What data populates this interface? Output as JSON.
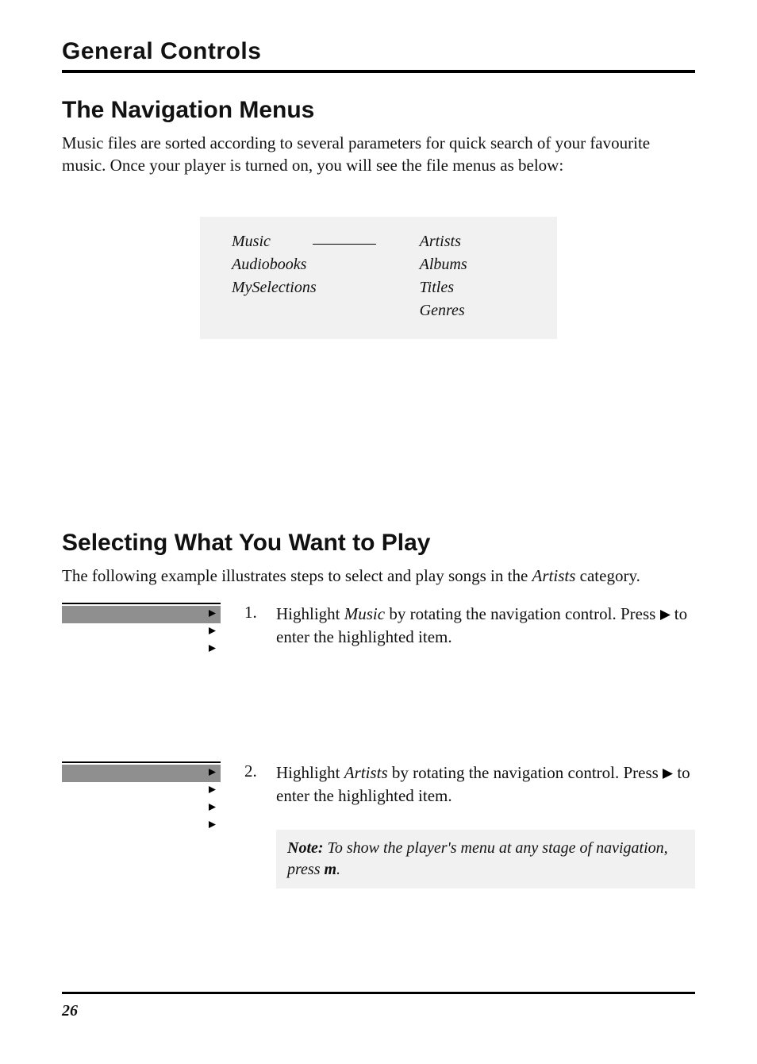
{
  "chapter": "General Controls",
  "section1": {
    "heading": "The Navigation Menus",
    "intro": "Music files are sorted according to several parameters for quick search of your favourite music. Once your player is turned on, you will see the file menus as below:"
  },
  "menu": {
    "left": [
      "Music",
      "Audiobooks",
      "MySelections"
    ],
    "right": [
      "Artists",
      "Albums",
      "Titles",
      "Genres"
    ]
  },
  "section2": {
    "heading": "Selecting What You Want to Play",
    "intro_pre": "The following example illustrates steps to select and play songs in the ",
    "intro_em": "Artists",
    "intro_post": " category."
  },
  "steps": [
    {
      "num": "1.",
      "pre": "Highlight ",
      "em": "Music",
      "mid": " by rotating the navigation control. Press ",
      "post": " to enter the highlighted item.",
      "screen_rows": 3
    },
    {
      "num": "2.",
      "pre": "Highlight ",
      "em": "Artists",
      "mid": " by rotating the navigation control. Press ",
      "post": " to enter the highlighted item.",
      "screen_rows": 4
    }
  ],
  "note": {
    "label": "Note:",
    "text_pre": " To show the player's menu at any stage of navigation, press ",
    "m": "m",
    "text_post": "."
  },
  "page_number": "26"
}
